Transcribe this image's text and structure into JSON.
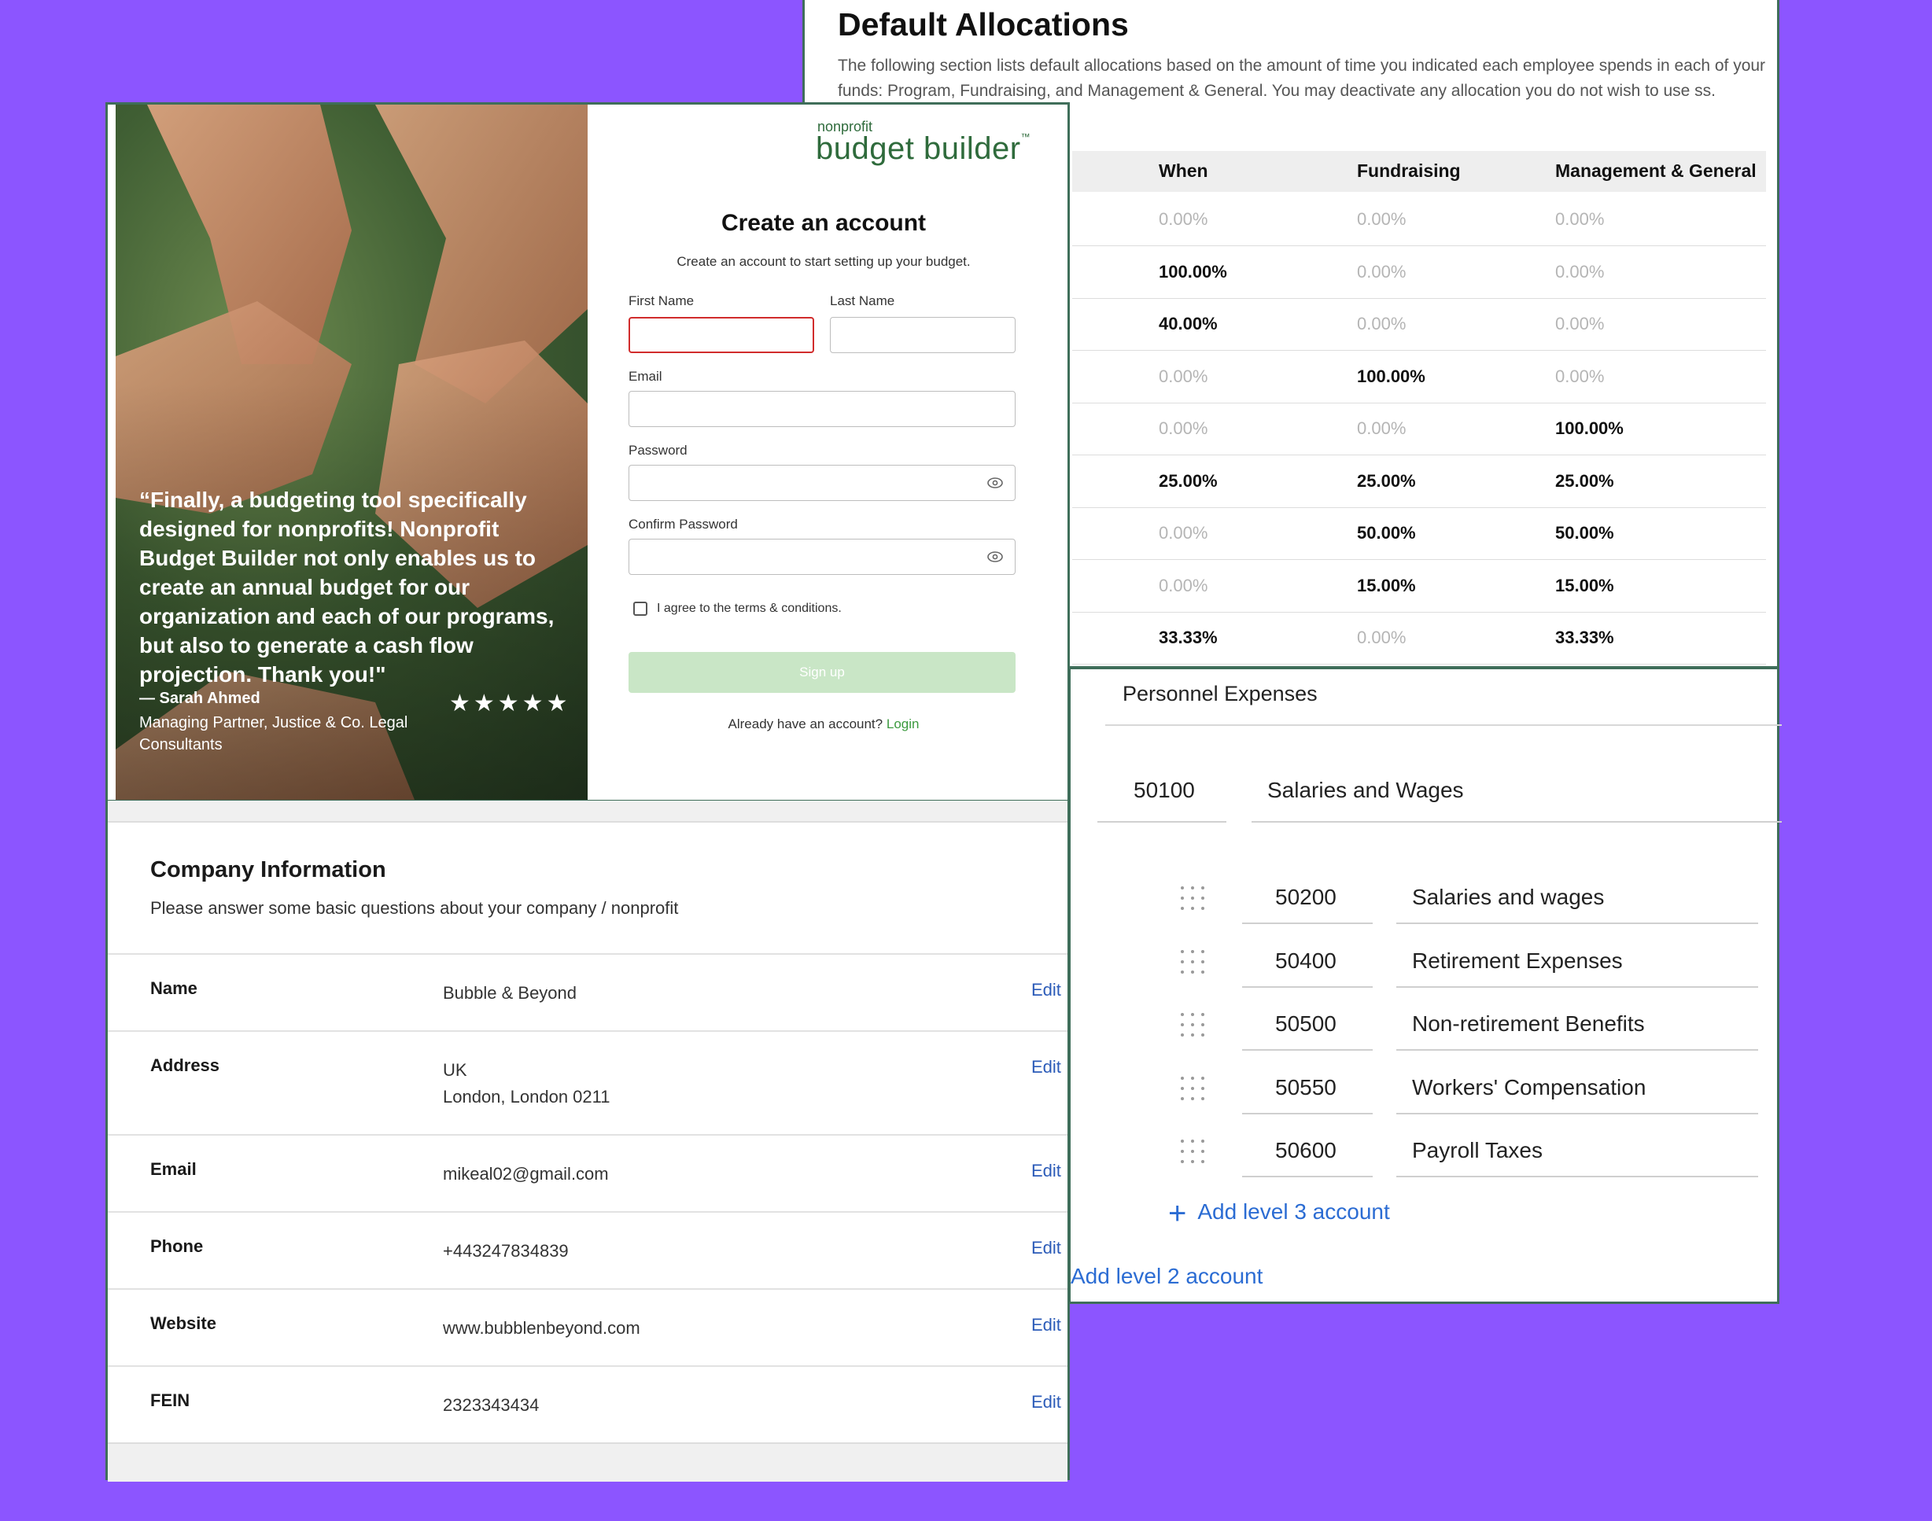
{
  "allocations": {
    "title": "Default Allocations",
    "description": "The following section lists default allocations based on the amount of time you indicated each employee spends in each of your funds: Program, Fundraising, and Management & General. You may deactivate any allocation you do not wish to use ss.",
    "columns": [
      "When",
      "Fundraising",
      "Management & General"
    ],
    "rows": [
      [
        "0.00%",
        "0.00%",
        "0.00%"
      ],
      [
        "100.00%",
        "0.00%",
        "0.00%"
      ],
      [
        "40.00%",
        "0.00%",
        "0.00%"
      ],
      [
        "0.00%",
        "100.00%",
        "0.00%"
      ],
      [
        "0.00%",
        "0.00%",
        "100.00%"
      ],
      [
        "25.00%",
        "25.00%",
        "25.00%"
      ],
      [
        "0.00%",
        "50.00%",
        "50.00%"
      ],
      [
        "0.00%",
        "15.00%",
        "15.00%"
      ],
      [
        "33.33%",
        "0.00%",
        "33.33%"
      ]
    ]
  },
  "accounts": {
    "level1_name": "Personnel Expenses",
    "level2_code": "50100",
    "level2_name": "Salaries and Wages",
    "level3": [
      {
        "code": "50200",
        "name": "Salaries and wages"
      },
      {
        "code": "50400",
        "name": "Retirement Expenses"
      },
      {
        "code": "50500",
        "name": "Non-retirement Benefits"
      },
      {
        "code": "50550",
        "name": "Workers' Compensation"
      },
      {
        "code": "50600",
        "name": "Payroll Taxes"
      }
    ],
    "add_level3_label": "Add level 3 account",
    "add_level3_icon": "plus-icon",
    "add_level2_label": "Add level 2 account",
    "link_color": "#2b6cd3"
  },
  "signup": {
    "quote": "“Finally, a budgeting tool specifically designed for nonprofits! Nonprofit Budget Builder not only enables us to create an annual budget for our organization and each of our programs, but also to generate a cash flow projection. Thank you!\"",
    "author": "— Sarah Ahmed",
    "author_role": "Managing Partner, Justice & Co. Legal Consultants",
    "stars": "★★★★★",
    "logo_top": "nonprofit",
    "logo_main": "budget builder",
    "logo_tm": "™",
    "heading": "Create an account",
    "subheading": "Create an account to start setting up your budget.",
    "first_name_label": "First Name",
    "last_name_label": "Last Name",
    "email_label": "Email",
    "password_label": "Password",
    "confirm_password_label": "Confirm Password",
    "terms_label": "I agree to the terms & conditions.",
    "signup_button": "Sign up",
    "have_account": "Already have an account?",
    "login_link": "Login",
    "brand_color": "#2f6b3c",
    "error_color": "#d12c2c",
    "button_color": "#c9e6c6"
  },
  "company": {
    "title": "Company Information",
    "description": "Please answer some basic questions about your company / nonprofit",
    "edit_label": "Edit",
    "fields": [
      {
        "label": "Name",
        "value": "Bubble & Beyond"
      },
      {
        "label": "Address",
        "value": "UK",
        "value2": "London, London 0211"
      },
      {
        "label": "Email",
        "value": "mikeal02@gmail.com"
      },
      {
        "label": "Phone",
        "value": "+443247834839"
      },
      {
        "label": "Website",
        "value": "www.bubblenbeyond.com"
      },
      {
        "label": "FEIN",
        "value": "2323343434"
      }
    ]
  }
}
